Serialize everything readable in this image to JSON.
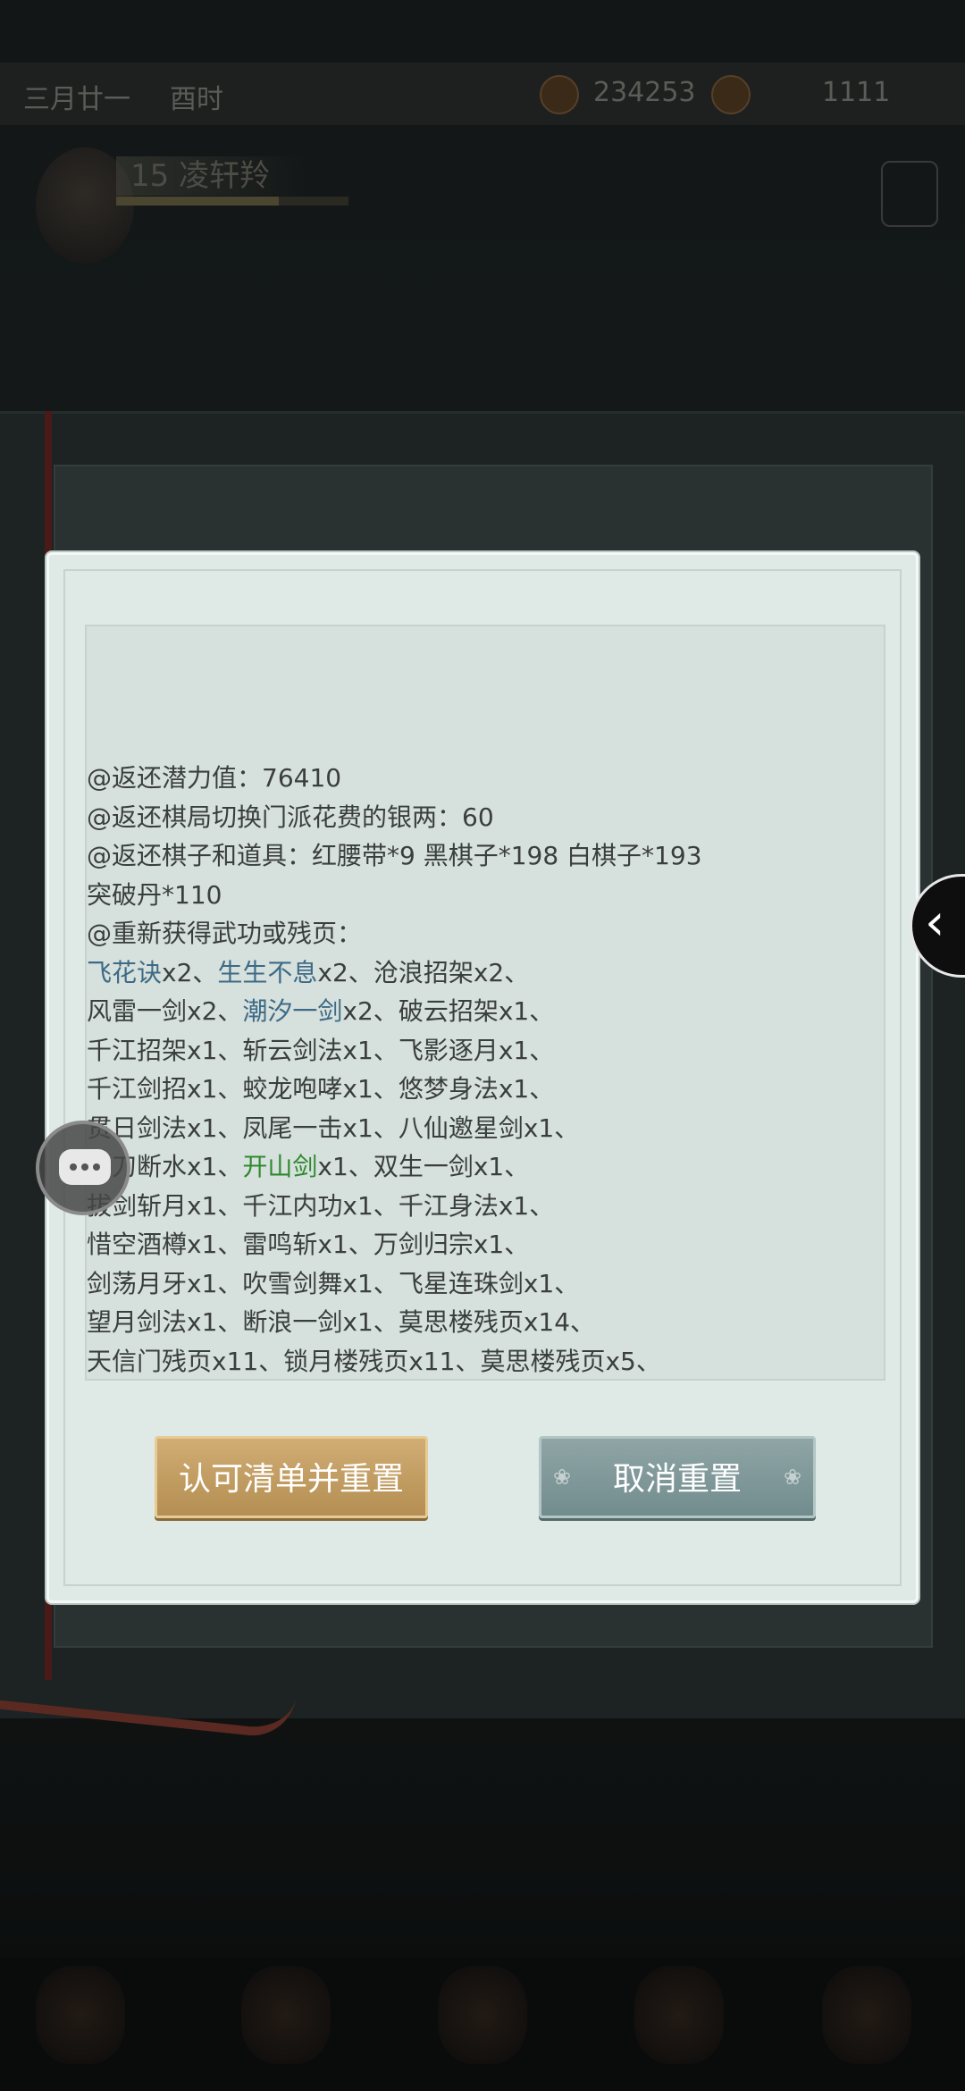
{
  "status": {
    "date": "三月廿一",
    "time": "酉时",
    "currency1": "234253",
    "currency2": "1111"
  },
  "character": {
    "level": "15",
    "name": "凌轩羚"
  },
  "scroll": {
    "lines": [
      "@返还潜力值：76410",
      "@返还棋局切换门派花费的银两：60",
      "@返还棋子和道具：红腰带*9 黑棋子*198 白棋子*193",
      "突破丹*110",
      "@重新获得武功或残页："
    ],
    "skills": [
      [
        {
          "t": "飞花诀",
          "c": "blue"
        },
        {
          "t": "x2、"
        },
        {
          "t": "生生不息",
          "c": "blue"
        },
        {
          "t": "x2、"
        },
        {
          "t": "沧浪招架",
          "c": "plain"
        },
        {
          "t": "x2、"
        }
      ],
      [
        {
          "t": "风雷一剑",
          "c": "plain"
        },
        {
          "t": "x2、"
        },
        {
          "t": "潮汐一剑",
          "c": "blue"
        },
        {
          "t": "x2、"
        },
        {
          "t": "破云招架",
          "c": "plain"
        },
        {
          "t": "x1、"
        }
      ],
      [
        {
          "t": "千江招架",
          "c": "plain"
        },
        {
          "t": "x1、"
        },
        {
          "t": "斩云剑法",
          "c": "plain"
        },
        {
          "t": "x1、"
        },
        {
          "t": "飞影逐月",
          "c": "plain"
        },
        {
          "t": "x1、"
        }
      ],
      [
        {
          "t": "千江剑招",
          "c": "plain"
        },
        {
          "t": "x1、"
        },
        {
          "t": "蛟龙咆哮",
          "c": "plain"
        },
        {
          "t": "x1、"
        },
        {
          "t": "悠梦身法",
          "c": "plain"
        },
        {
          "t": "x1、"
        }
      ],
      [
        {
          "t": "贯日剑法",
          "c": "plain"
        },
        {
          "t": "x1、"
        },
        {
          "t": "凤尾一击",
          "c": "plain"
        },
        {
          "t": "x1、"
        },
        {
          "t": "八仙邀星剑",
          "c": "plain"
        },
        {
          "t": "x1、"
        }
      ],
      [
        {
          "t": "抽刀断水",
          "c": "plain"
        },
        {
          "t": "x1、"
        },
        {
          "t": "开山剑",
          "c": "green"
        },
        {
          "t": "x1、"
        },
        {
          "t": "双生一剑",
          "c": "plain"
        },
        {
          "t": "x1、"
        }
      ],
      [
        {
          "t": "拔剑斩月",
          "c": "plain"
        },
        {
          "t": "x1、"
        },
        {
          "t": "千江内功",
          "c": "plain"
        },
        {
          "t": "x1、"
        },
        {
          "t": "千江身法",
          "c": "plain"
        },
        {
          "t": "x1、"
        }
      ],
      [
        {
          "t": "惜空酒樽",
          "c": "plain"
        },
        {
          "t": "x1、"
        },
        {
          "t": "雷鸣斩",
          "c": "plain"
        },
        {
          "t": "x1、"
        },
        {
          "t": "万剑归宗",
          "c": "plain"
        },
        {
          "t": "x1、"
        }
      ],
      [
        {
          "t": "剑荡月牙",
          "c": "plain"
        },
        {
          "t": "x1、"
        },
        {
          "t": "吹雪剑舞",
          "c": "plain"
        },
        {
          "t": "x1、"
        },
        {
          "t": "飞星连珠剑",
          "c": "plain"
        },
        {
          "t": "x1、"
        }
      ],
      [
        {
          "t": "望月剑法",
          "c": "plain"
        },
        {
          "t": "x1、"
        },
        {
          "t": "断浪一剑",
          "c": "plain"
        },
        {
          "t": "x1、"
        },
        {
          "t": "莫思楼残页",
          "c": "plain"
        },
        {
          "t": "x14、"
        }
      ],
      [
        {
          "t": "天信门残页",
          "c": "plain"
        },
        {
          "t": "x11、"
        },
        {
          "t": "锁月楼残页",
          "c": "plain"
        },
        {
          "t": "x11、"
        },
        {
          "t": "莫思楼残页",
          "c": "plain"
        },
        {
          "t": "x5、"
        }
      ]
    ]
  },
  "buttons": {
    "confirm": "认可清单并重置",
    "cancel": "取消重置"
  },
  "icons": {
    "side_arrow": "chevron-left-icon",
    "chat": "chat-bubble-icon"
  }
}
